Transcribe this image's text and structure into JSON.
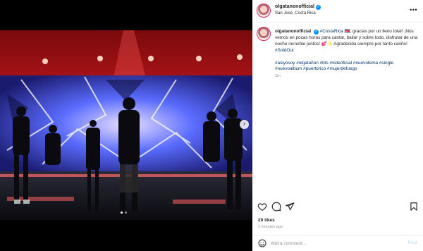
{
  "post": {
    "username": "olgatanonofficial",
    "location": "San José, Costa Rica",
    "verified_mark": "✓",
    "more_label": "•••"
  },
  "caption": {
    "username": "olgatanonofficial",
    "mention": "#CostaRica",
    "line1_flag": "🇨🇷",
    "line1_rest": ", gracias por un lleno total! ¡Nos vemos en pocas horas para cantar, bailar y sobre todo, disfrutar de una noche increíble juntos! 💕✨ Agradecida siempre por tanto cariño!",
    "soldout": "#SoldOut",
    "hashtags": [
      "#asiyosoy",
      "#olgatañon",
      "#bts",
      "#videoficial",
      "#nuevotema",
      "#single",
      "#nuevoalbum",
      "#puertorico",
      "#mujerdefuego"
    ],
    "time": "2m"
  },
  "stats": {
    "likes": "20 likes",
    "time_ago": "2 minutes ago"
  },
  "comment": {
    "placeholder": "Add a comment...",
    "post_label": "Post"
  },
  "carousel": {
    "next_label": "›",
    "slide_count": 2,
    "active_slide": 1
  },
  "icons": {
    "like": "heart-icon",
    "comment": "comment-icon",
    "share": "paper-plane-icon",
    "save": "bookmark-icon",
    "emoji": "smiley-icon",
    "more": "more-horizontal-icon",
    "next": "chevron-right-icon"
  },
  "colors": {
    "link": "#00376b",
    "verified": "#0095f6",
    "muted": "#8e8e8e",
    "text": "#262626"
  }
}
